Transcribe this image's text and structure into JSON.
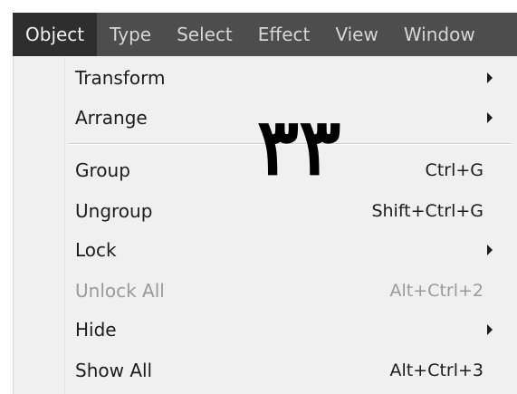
{
  "menubar": {
    "items": [
      {
        "label": "Object",
        "active": true
      },
      {
        "label": "Type"
      },
      {
        "label": "Select"
      },
      {
        "label": "Effect"
      },
      {
        "label": "View"
      },
      {
        "label": "Window"
      }
    ]
  },
  "menu": {
    "items": [
      {
        "label": "Transform",
        "shortcut": "",
        "submenu": true,
        "enabled": true
      },
      {
        "label": "Arrange",
        "shortcut": "",
        "submenu": true,
        "enabled": true
      },
      {
        "label": "Group",
        "shortcut": "Ctrl+G",
        "submenu": false,
        "enabled": true
      },
      {
        "label": "Ungroup",
        "shortcut": "Shift+Ctrl+G",
        "submenu": false,
        "enabled": true
      },
      {
        "label": "Lock",
        "shortcut": "",
        "submenu": true,
        "enabled": true
      },
      {
        "label": "Unlock All",
        "shortcut": "Alt+Ctrl+2",
        "submenu": false,
        "enabled": false
      },
      {
        "label": "Hide",
        "shortcut": "",
        "submenu": true,
        "enabled": true
      },
      {
        "label": "Show All",
        "shortcut": "Alt+Ctrl+3",
        "submenu": false,
        "enabled": true
      }
    ]
  },
  "overlay": {
    "text": "۳۳"
  },
  "colors": {
    "menubar_bg": "#4d4d4d",
    "menubar_active_bg": "#2e2e2e",
    "menu_bg": "#f0f0f0",
    "disabled_text": "#9a9a9a"
  }
}
